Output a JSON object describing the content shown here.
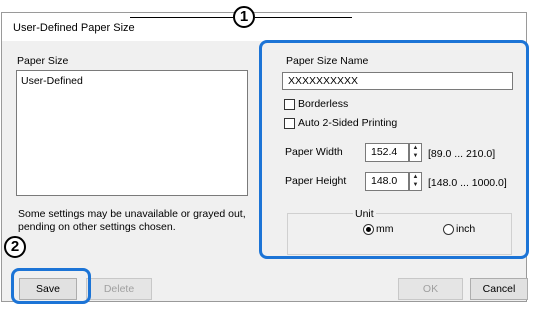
{
  "dialog": {
    "title": "User-Defined Paper Size"
  },
  "left_panel": {
    "paper_size_label": "Paper Size",
    "list_items": [
      "User-Defined"
    ],
    "note_line1": "Some settings may be unavailable or grayed out,",
    "note_line2": "pending on other settings chosen."
  },
  "right_panel": {
    "paper_size_name_label": "Paper Size Name",
    "paper_size_name_value": "XXXXXXXXXX",
    "borderless_label": "Borderless",
    "borderless_checked": false,
    "auto2sided_label": "Auto 2-Sided Printing",
    "auto2sided_checked": false,
    "paper_width_label": "Paper Width",
    "paper_width_value": "152.4",
    "paper_width_range": "[89.0 ... 210.0]",
    "paper_height_label": "Paper Height",
    "paper_height_value": "148.0",
    "paper_height_range": "[148.0 ... 1000.0]",
    "unit_label": "Unit",
    "unit_mm_label": "mm",
    "unit_inch_label": "inch",
    "unit_selected": "mm"
  },
  "buttons": {
    "save": "Save",
    "delete": "Delete",
    "ok": "OK",
    "cancel": "Cancel"
  },
  "callouts": {
    "one": "1",
    "two": "2"
  },
  "colors": {
    "highlight": "#1c74d6",
    "dialog_bg": "#f0f0f0"
  }
}
